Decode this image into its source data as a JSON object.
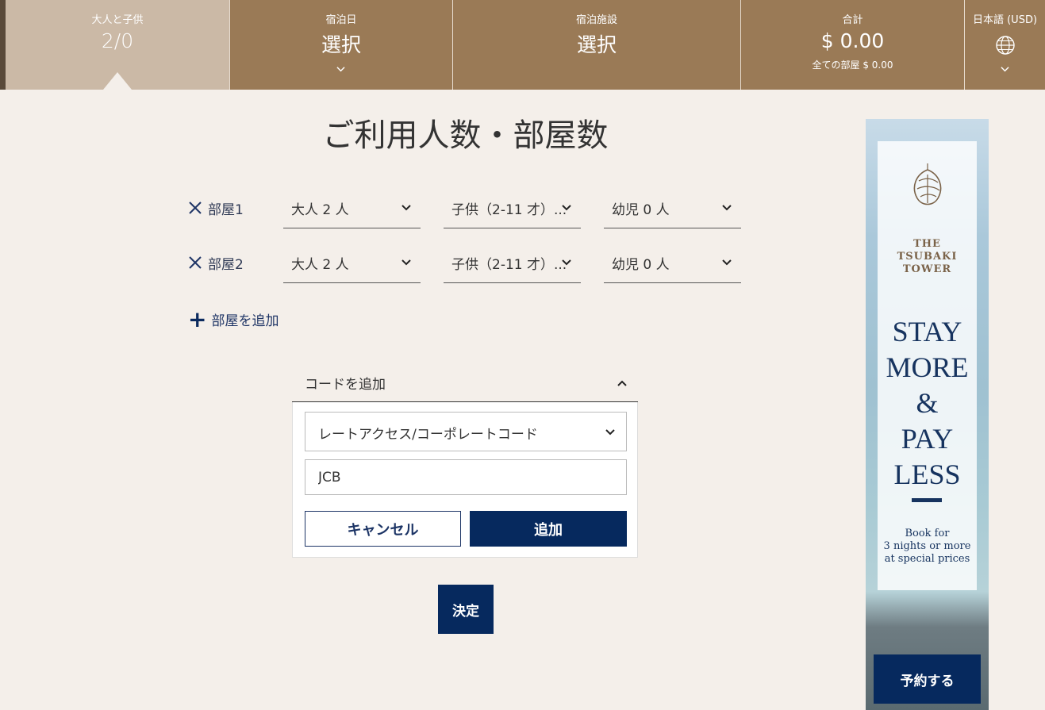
{
  "topbar": {
    "guests": {
      "label": "大人と子供",
      "value": "2/0"
    },
    "dates": {
      "label": "宿泊日",
      "value": "選択"
    },
    "hotel": {
      "label": "宿泊施設",
      "value": "選択"
    },
    "total": {
      "label": "合計",
      "value": "$ 0.00",
      "sub": "全ての部屋 $ 0.00"
    },
    "language": {
      "label": "日本語 (USD)",
      "icon": "globe-icon"
    }
  },
  "page": {
    "title": "ご利用人数・部屋数"
  },
  "rooms": [
    {
      "label": "部屋1",
      "adults": "大人 2 人",
      "children": "子供（2-11 才）...",
      "infants": "幼児 0 人"
    },
    {
      "label": "部屋2",
      "adults": "大人 2 人",
      "children": "子供（2-11 才）...",
      "infants": "幼児 0 人"
    }
  ],
  "add_room": {
    "label": "部屋を追加"
  },
  "code": {
    "header": "コードを追加",
    "type_selected": "レートアクセス/コーポレートコード",
    "value": "JCB",
    "cancel_label": "キャンセル",
    "add_label": "追加"
  },
  "confirm_label": "決定",
  "ad": {
    "brand": [
      "THE",
      "TSUBAKI",
      "TOWER"
    ],
    "slogan": [
      "STAY",
      "MORE",
      "&",
      "PAY",
      "LESS"
    ],
    "copy": [
      "Book for",
      "3 nights or more",
      "at special prices"
    ],
    "button_label": "予約する"
  },
  "colors": {
    "topbar": "#9a7a56",
    "topbar_active": "#cbb9a6",
    "primary": "#06295e",
    "background": "#f4efea"
  }
}
